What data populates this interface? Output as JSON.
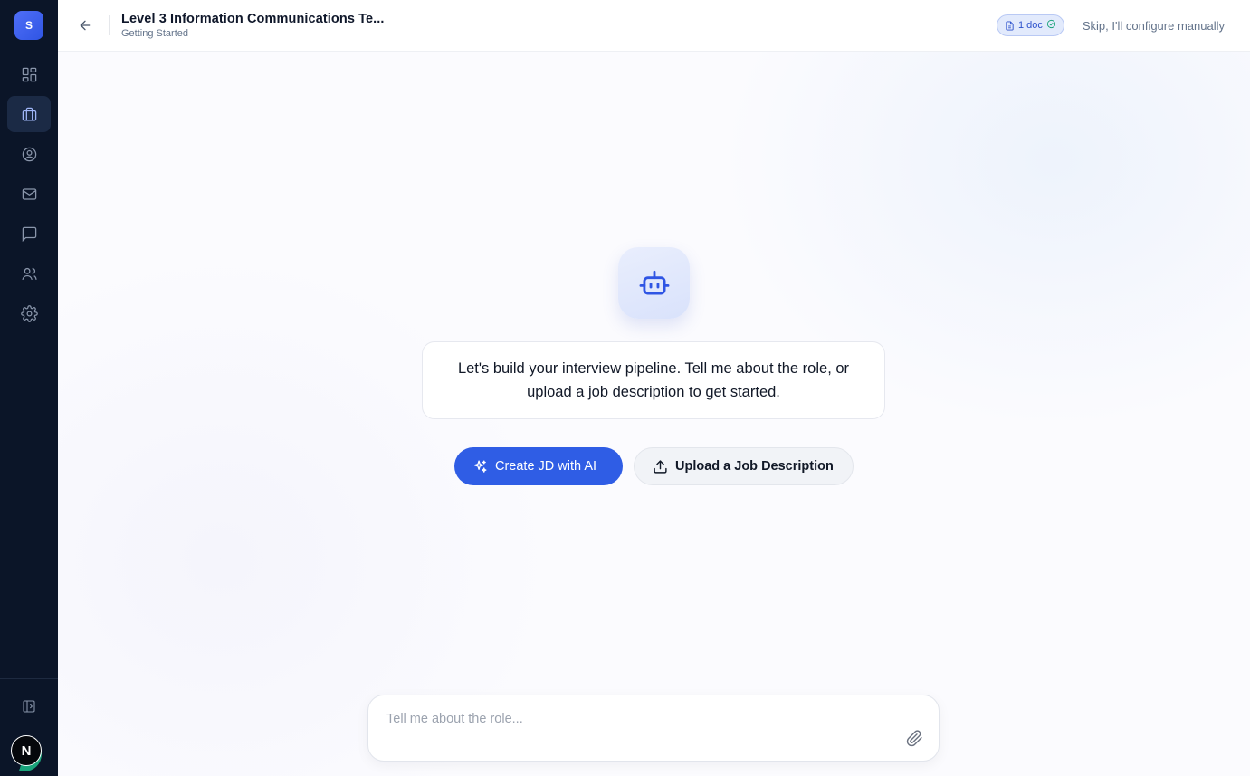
{
  "app": {
    "logo_letter": "S",
    "avatar_initial": "N"
  },
  "sidebar": {
    "items": [
      {
        "name": "dashboard",
        "icon": "grid-icon",
        "active": false
      },
      {
        "name": "jobs",
        "icon": "briefcase-icon",
        "active": true
      },
      {
        "name": "candidates",
        "icon": "user-circle-icon",
        "active": false
      },
      {
        "name": "inbox",
        "icon": "mail-icon",
        "active": false
      },
      {
        "name": "messages",
        "icon": "chat-icon",
        "active": false
      },
      {
        "name": "team",
        "icon": "users-icon",
        "active": false
      },
      {
        "name": "settings",
        "icon": "gear-icon",
        "active": false
      }
    ]
  },
  "header": {
    "title": "Level 3 Information Communications Te...",
    "subtitle": "Getting Started",
    "doc_badge": "1 doc",
    "skip_label": "Skip, I'll configure manually"
  },
  "main": {
    "message": "Let's build your interview pipeline. Tell me about the role, or upload a job description to get started.",
    "create_button": "Create JD with AI",
    "upload_button": "Upload a Job Description",
    "composer_placeholder": "Tell me about the role..."
  },
  "colors": {
    "sidebar_bg": "#0b1528",
    "accent": "#2f5de5",
    "success": "#1aa37a"
  }
}
